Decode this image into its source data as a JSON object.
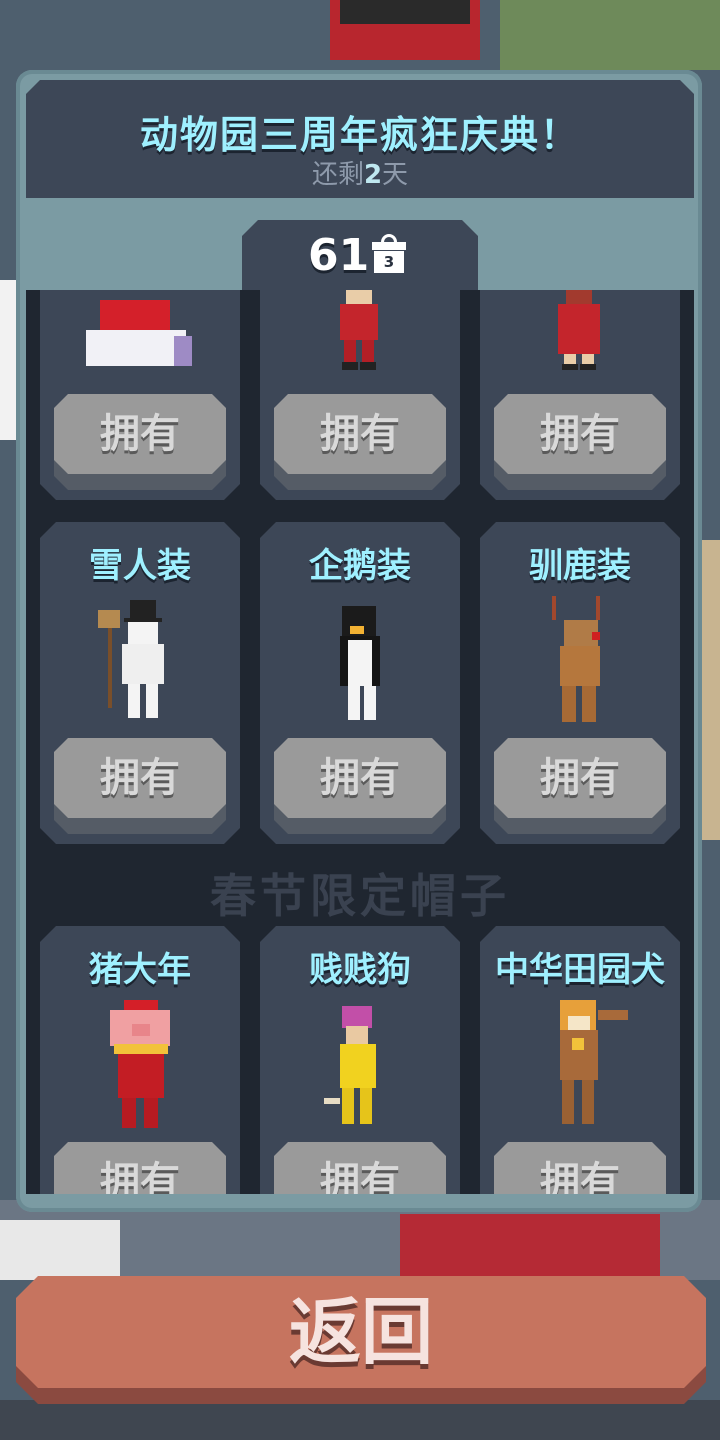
{
  "event": {
    "title": "动物园三周年疯狂庆典！",
    "remaining_prefix": "还剩",
    "remaining_days": "2",
    "remaining_suffix": "天"
  },
  "currency": {
    "count": "61",
    "gift_badge": "3",
    "icon": "gift-calendar-icon"
  },
  "rows": [
    {
      "items": [
        {
          "name": "",
          "icon": "santa-hat-icon",
          "button": "拥有"
        },
        {
          "name": "",
          "icon": "santa-suit-icon",
          "button": "拥有"
        },
        {
          "name": "",
          "icon": "santa-dress-icon",
          "button": "拥有"
        }
      ]
    },
    {
      "items": [
        {
          "name": "雪人装",
          "icon": "snowman-costume-icon",
          "button": "拥有"
        },
        {
          "name": "企鹅装",
          "icon": "penguin-costume-icon",
          "button": "拥有"
        },
        {
          "name": "驯鹿装",
          "icon": "reindeer-costume-icon",
          "button": "拥有"
        }
      ]
    }
  ],
  "section": {
    "title": "春节限定帽子",
    "items": [
      {
        "name": "猪大年",
        "icon": "pig-costume-icon",
        "button": "拥有"
      },
      {
        "name": "贱贱狗",
        "icon": "banana-dog-costume-icon",
        "button": "拥有"
      },
      {
        "name": "中华田园犬",
        "icon": "shiba-dog-costume-icon",
        "button": "拥有"
      }
    ]
  },
  "back_button": "返回",
  "colors": {
    "title_cyan": "#9ff0ff",
    "panel_bg": "#7b9ba3",
    "card_bg": "#3d4757",
    "back_button": "#c6745f"
  }
}
